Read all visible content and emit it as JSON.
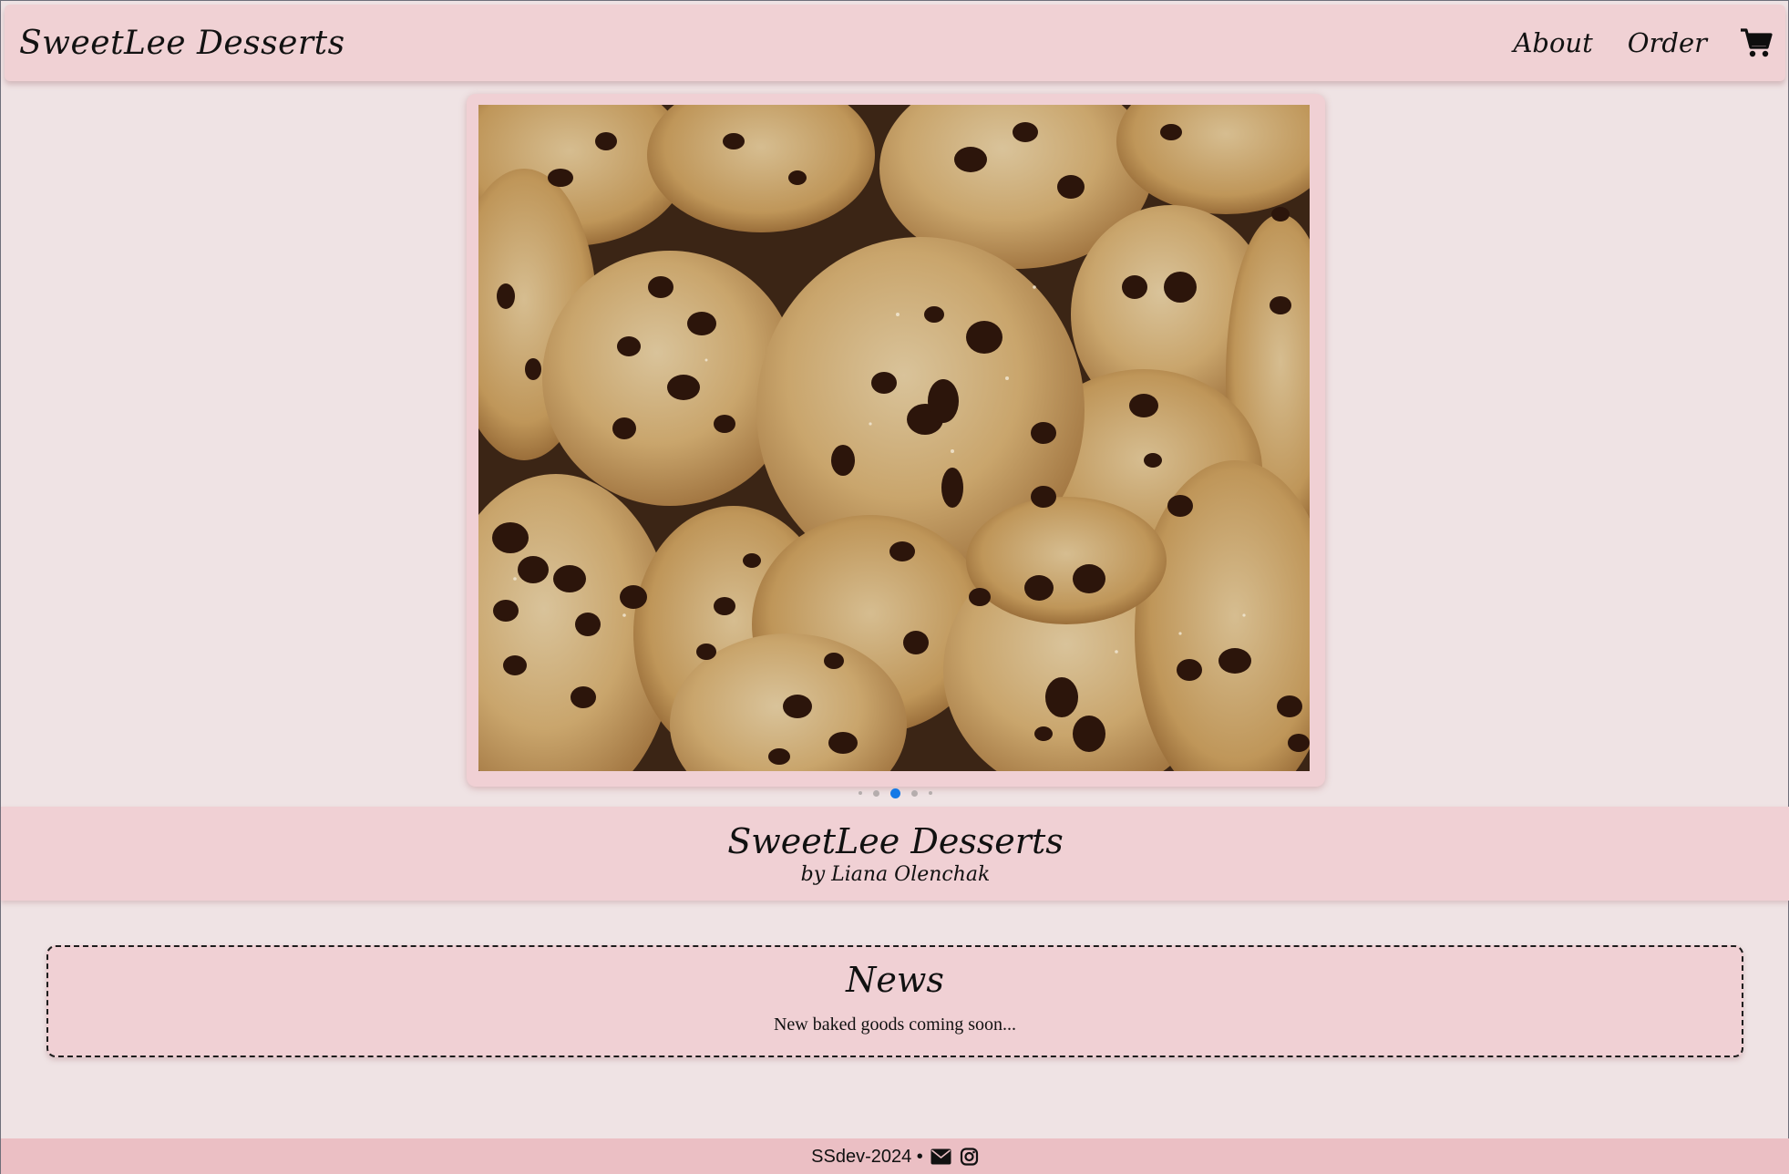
{
  "navbar": {
    "brand": "SweetLee Desserts",
    "links": [
      {
        "label": "About"
      },
      {
        "label": "Order"
      }
    ],
    "cart_icon": "shopping-cart-icon"
  },
  "carousel": {
    "image_alt": "Chocolate chip cookies",
    "slide_count": 5,
    "active_index": 2
  },
  "hero": {
    "title": "SweetLee Desserts",
    "subtitle": "by Liana Olenchak"
  },
  "news": {
    "title": "News",
    "text": "New baked goods coming soon..."
  },
  "footer": {
    "text": "SSdev-2024 •",
    "icons": [
      "envelope-icon",
      "instagram-icon"
    ]
  },
  "colors": {
    "page_background": "#efe3e4",
    "header_pink": "#f0d0d4",
    "footer_pink": "#ebbfc4",
    "active_dot": "#1479e6"
  }
}
